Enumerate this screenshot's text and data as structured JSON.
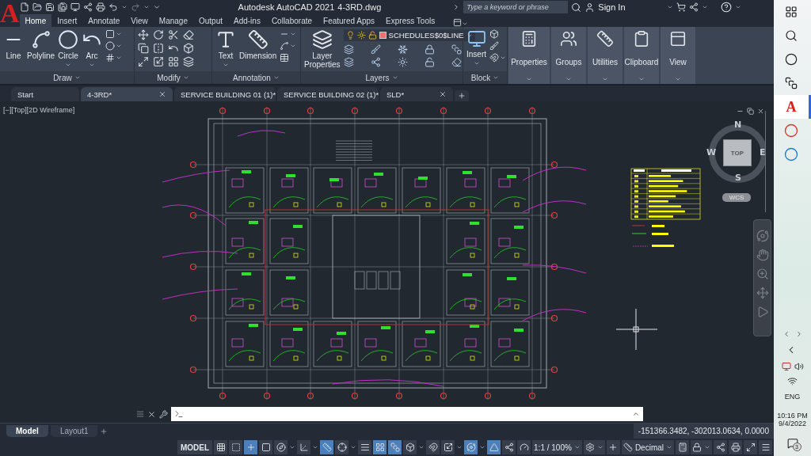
{
  "app": {
    "logo": "A",
    "title": "Autodesk AutoCAD 2021",
    "file": "4-3RD.dwg"
  },
  "search": {
    "placeholder": "Type a keyword or phrase"
  },
  "account": {
    "label": "Sign In"
  },
  "ribbon_tabs": [
    {
      "label": "Home",
      "selected": true
    },
    {
      "label": "Insert",
      "selected": false
    },
    {
      "label": "Annotate",
      "selected": false
    },
    {
      "label": "View",
      "selected": false
    },
    {
      "label": "Manage",
      "selected": false
    },
    {
      "label": "Output",
      "selected": false
    },
    {
      "label": "Add-ins",
      "selected": false
    },
    {
      "label": "Collaborate",
      "selected": false
    },
    {
      "label": "Featured Apps",
      "selected": false
    },
    {
      "label": "Express Tools",
      "selected": false
    }
  ],
  "draw_panel": {
    "title": "Draw",
    "tools": [
      "Line",
      "Polyline",
      "Circle",
      "Arc"
    ]
  },
  "modify_panel": {
    "title": "Modify"
  },
  "annotation_panel": {
    "title": "Annotation",
    "tools": [
      "Text",
      "Dimension"
    ]
  },
  "layers_panel": {
    "title": "Layers",
    "tool": "Layer Properties",
    "current_layer": "SCHEDULES$0$LINE"
  },
  "block_panel": {
    "title": "Block",
    "tool": "Insert"
  },
  "collapsed_panels": [
    "Properties",
    "Groups",
    "Utilities",
    "Clipboard",
    "View"
  ],
  "document_tabs": [
    {
      "label": "Start",
      "selected": false
    },
    {
      "label": "4-3RD*",
      "selected": true
    },
    {
      "label": "SERVICE BUILDING 01 (1)*",
      "selected": false
    },
    {
      "label": "SERVICE BUILDING 02 (1)*",
      "selected": false
    },
    {
      "label": "SLD*",
      "selected": false
    }
  ],
  "viewport_label": "[−][Top][2D Wireframe]",
  "viewcube": {
    "top": "TOP",
    "north": "N",
    "south": "S",
    "east": "E",
    "west": "W",
    "ucs": "WCS"
  },
  "layout_tabs": [
    {
      "label": "Model",
      "selected": true
    },
    {
      "label": "Layout1",
      "selected": false
    }
  ],
  "coordinates": "-151366.3482, -302013.0634, 0.0000",
  "status_bar": {
    "model": "MODEL",
    "scale": "1:1 / 100%",
    "units": "Decimal",
    "toggles": [
      {
        "on": false
      },
      {
        "on": false
      },
      {
        "on": true
      },
      {
        "on": false
      },
      {
        "on": false
      },
      {
        "on": false
      },
      {
        "on": true
      },
      {
        "on": false
      },
      {
        "on": false
      },
      {
        "on": true
      },
      {
        "on": true
      },
      {
        "on": false
      },
      {
        "on": false
      },
      {
        "on": false
      },
      {
        "on": true
      },
      {
        "on": true
      },
      {
        "on": false
      },
      {
        "on": false
      }
    ]
  },
  "taskbar": {
    "app_letter": "A",
    "language": "ENG",
    "time": "10:16 PM",
    "date": "9/4/2022",
    "notifications": "3"
  }
}
